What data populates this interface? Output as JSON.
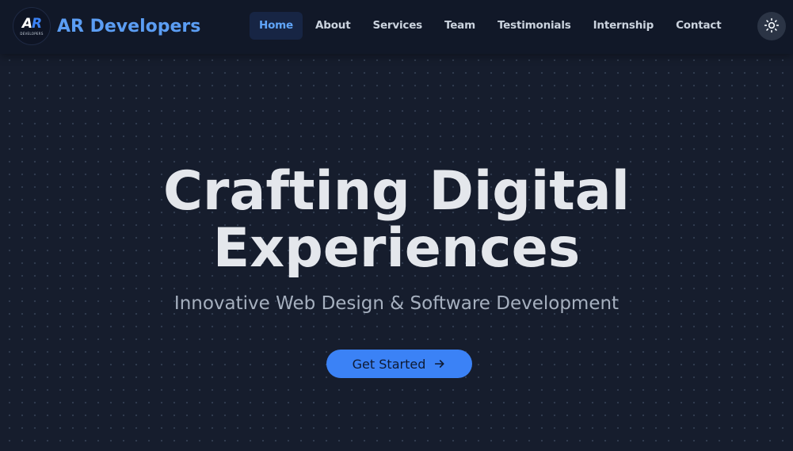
{
  "brand": {
    "logo_text": "AR",
    "logo_subtext": "DEVELOPERS",
    "name": "AR Developers"
  },
  "nav": {
    "items": [
      {
        "label": "Home",
        "active": true
      },
      {
        "label": "About",
        "active": false
      },
      {
        "label": "Services",
        "active": false
      },
      {
        "label": "Team",
        "active": false
      },
      {
        "label": "Testimonials",
        "active": false
      },
      {
        "label": "Internship",
        "active": false
      },
      {
        "label": "Contact",
        "active": false
      }
    ],
    "theme_toggle_icon": "sun-icon"
  },
  "hero": {
    "title_line1": "Crafting Digital",
    "title_line2": "Experiences",
    "subtitle": "Innovative Web Design & Software Development",
    "cta_label": "Get Started",
    "cta_icon": "arrow-right-icon"
  },
  "colors": {
    "background": "#161d2d",
    "navbar": "#111828",
    "accent": "#3b82f6",
    "brand_text": "#5b9df3",
    "active_nav_bg": "#172544",
    "active_nav_text": "#60a5fa"
  }
}
